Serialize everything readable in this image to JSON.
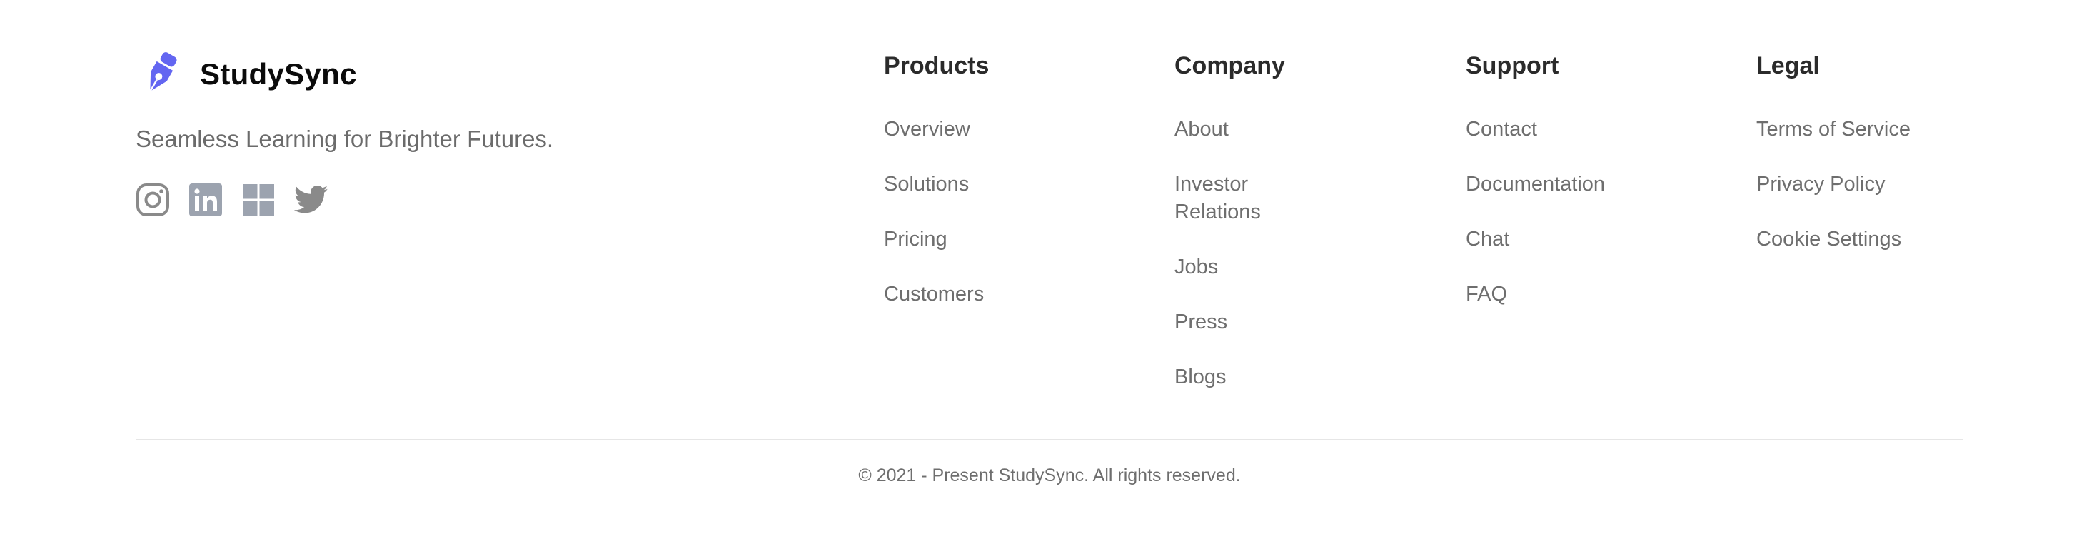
{
  "brand": {
    "name": "StudySync",
    "tagline": "Seamless Learning for Brighter Futures.",
    "logo_icon": "pen-nib-icon",
    "accent_color": "#6366f1"
  },
  "socials": [
    {
      "icon": "instagram-icon"
    },
    {
      "icon": "linkedin-icon"
    },
    {
      "icon": "windows-icon"
    },
    {
      "icon": "twitter-icon"
    }
  ],
  "columns": {
    "products": {
      "title": "Products",
      "links": [
        "Overview",
        "Solutions",
        "Pricing",
        "Customers"
      ]
    },
    "company": {
      "title": "Company",
      "links": [
        "About",
        "Investor Relations",
        "Jobs",
        "Press",
        "Blogs"
      ]
    },
    "support": {
      "title": "Support",
      "links": [
        "Contact",
        "Documentation",
        "Chat",
        "FAQ"
      ]
    },
    "legal": {
      "title": "Legal",
      "links": [
        "Terms of Service",
        "Privacy Policy",
        "Cookie Settings"
      ]
    }
  },
  "copyright": "© 2021 - Present StudySync. All rights reserved."
}
